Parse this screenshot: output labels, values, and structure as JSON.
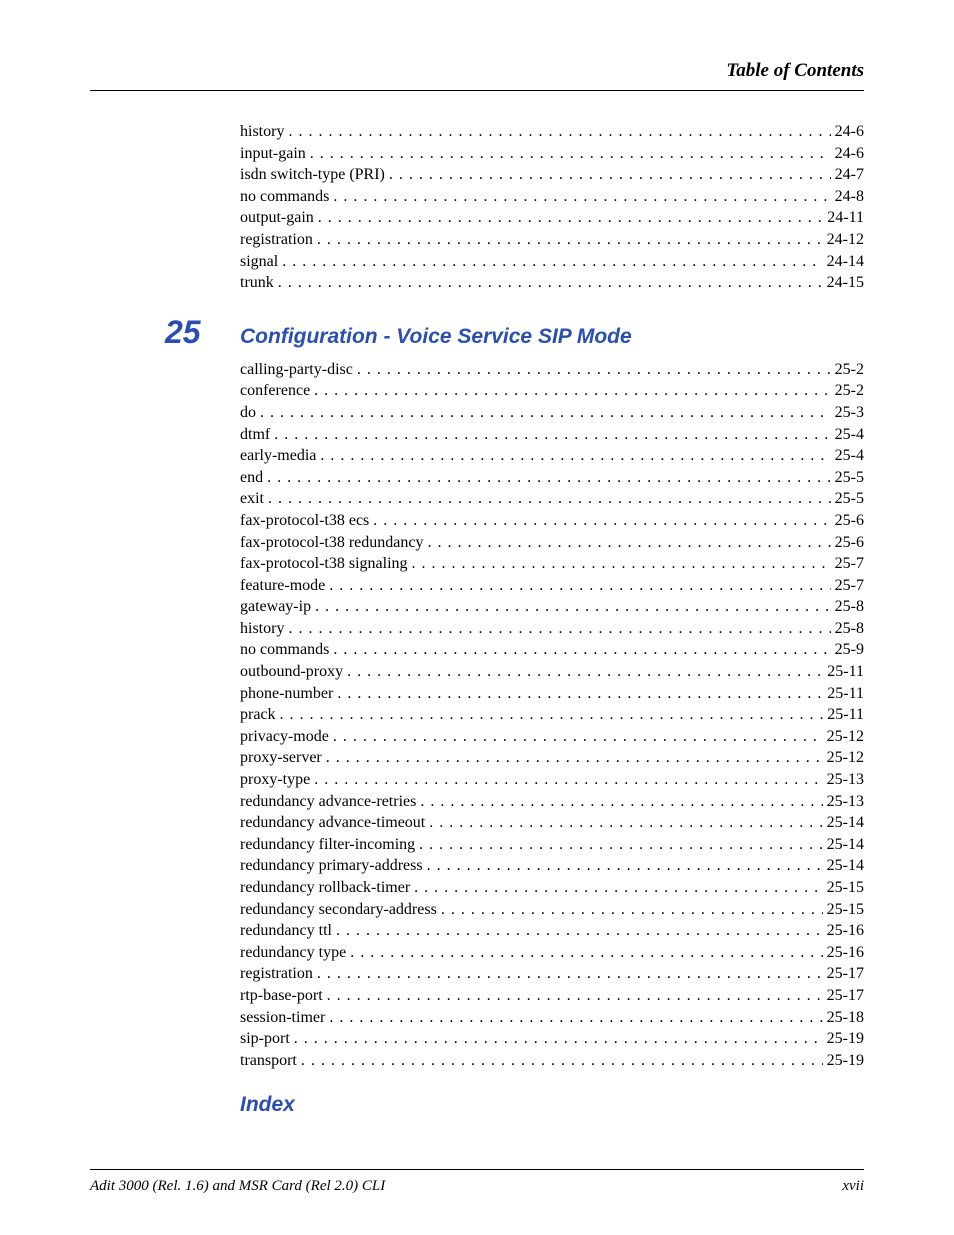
{
  "header": {
    "title": "Table of Contents"
  },
  "sections": [
    {
      "chapter_num": "",
      "chapter_title": "",
      "entries": [
        {
          "label": "history",
          "page": "24-6"
        },
        {
          "label": "input-gain",
          "page": "24-6"
        },
        {
          "label": "isdn switch-type (PRI)",
          "page": "24-7"
        },
        {
          "label": "no commands",
          "page": "24-8"
        },
        {
          "label": "output-gain",
          "page": "24-11"
        },
        {
          "label": "registration",
          "page": "24-12"
        },
        {
          "label": "signal",
          "page": "24-14"
        },
        {
          "label": "trunk",
          "page": "24-15"
        }
      ]
    },
    {
      "chapter_num": "25",
      "chapter_title": "Configuration - Voice Service SIP Mode",
      "entries": [
        {
          "label": "calling-party-disc",
          "page": "25-2"
        },
        {
          "label": "conference",
          "page": "25-2"
        },
        {
          "label": "do",
          "page": "25-3"
        },
        {
          "label": "dtmf",
          "page": "25-4"
        },
        {
          "label": "early-media",
          "page": "25-4"
        },
        {
          "label": "end",
          "page": "25-5"
        },
        {
          "label": "exit",
          "page": "25-5"
        },
        {
          "label": "fax-protocol-t38 ecs",
          "page": "25-6"
        },
        {
          "label": "fax-protocol-t38 redundancy",
          "page": "25-6"
        },
        {
          "label": "fax-protocol-t38 signaling",
          "page": "25-7"
        },
        {
          "label": "feature-mode",
          "page": "25-7"
        },
        {
          "label": "gateway-ip",
          "page": "25-8"
        },
        {
          "label": "history",
          "page": "25-8"
        },
        {
          "label": "no commands",
          "page": "25-9"
        },
        {
          "label": "outbound-proxy",
          "page": "25-11"
        },
        {
          "label": "phone-number",
          "page": "25-11"
        },
        {
          "label": "prack",
          "page": "25-11"
        },
        {
          "label": "privacy-mode",
          "page": "25-12"
        },
        {
          "label": "proxy-server",
          "page": "25-12"
        },
        {
          "label": "proxy-type",
          "page": "25-13"
        },
        {
          "label": "redundancy advance-retries",
          "page": "25-13"
        },
        {
          "label": "redundancy advance-timeout",
          "page": "25-14"
        },
        {
          "label": "redundancy filter-incoming",
          "page": "25-14"
        },
        {
          "label": "redundancy primary-address",
          "page": "25-14"
        },
        {
          "label": "redundancy rollback-timer",
          "page": "25-15"
        },
        {
          "label": "redundancy secondary-address",
          "page": "25-15"
        },
        {
          "label": "redundancy ttl",
          "page": "25-16"
        },
        {
          "label": "redundancy type",
          "page": "25-16"
        },
        {
          "label": "registration",
          "page": "25-17"
        },
        {
          "label": "rtp-base-port",
          "page": "25-17"
        },
        {
          "label": "session-timer",
          "page": "25-18"
        },
        {
          "label": "sip-port",
          "page": "25-19"
        },
        {
          "label": "transport",
          "page": "25-19"
        }
      ]
    }
  ],
  "index_title": "Index",
  "footer": {
    "left": "Adit 3000 (Rel. 1.6) and MSR Card (Rel 2.0) CLI",
    "right": "xvii"
  }
}
